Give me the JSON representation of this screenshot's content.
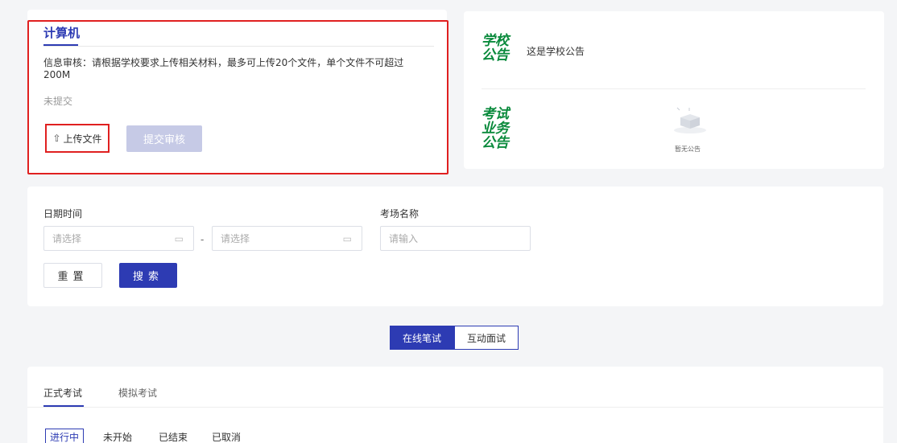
{
  "info": {
    "tab_title": "计算机",
    "description": "信息审核：请根据学校要求上传相关材料，最多可上传20个文件，单个文件不可超过200M",
    "status": "未提交",
    "upload_label": "上传文件",
    "submit_label": "提交审核"
  },
  "notice": {
    "school_tag": [
      "学校",
      "公告"
    ],
    "school_text": "这是学校公告",
    "exam_tag": [
      "考试",
      "业务",
      "公告"
    ],
    "empty_text": "暂无公告",
    "tag_color": "#0a8a3c"
  },
  "filter": {
    "date_label": "日期时间",
    "start_placeholder": "请选择",
    "range_separator": "-",
    "end_placeholder": "请选择",
    "room_label": "考场名称",
    "room_placeholder": "请输入",
    "reset_label": "重置",
    "search_label": "搜索"
  },
  "mode": {
    "online": "在线笔试",
    "interview": "互动面试",
    "accent": "#2d3bb3"
  },
  "exam_tabs": {
    "formal": "正式考试",
    "mock": "模拟考试"
  },
  "status_tabs": [
    "进行中",
    "未开始",
    "已结束",
    "已取消"
  ]
}
